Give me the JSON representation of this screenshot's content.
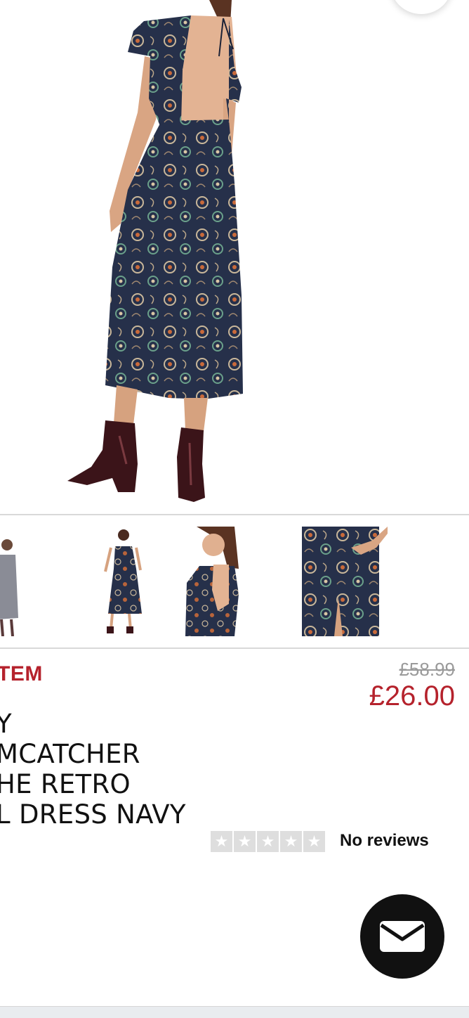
{
  "product": {
    "badge": "TEM",
    "was_price": "£58.99",
    "now_price": "£26.00",
    "title_lines": [
      "Y",
      "MCATCHER",
      "HE RETRO",
      "L DRESS NAVY"
    ],
    "reviews_label": "No reviews",
    "rating": 0
  },
  "colors": {
    "sale_red": "#b5222c",
    "dress_navy": "#26304a",
    "boots": "#3b1419"
  },
  "icons": {
    "chat": "envelope-icon",
    "star": "star-icon"
  }
}
